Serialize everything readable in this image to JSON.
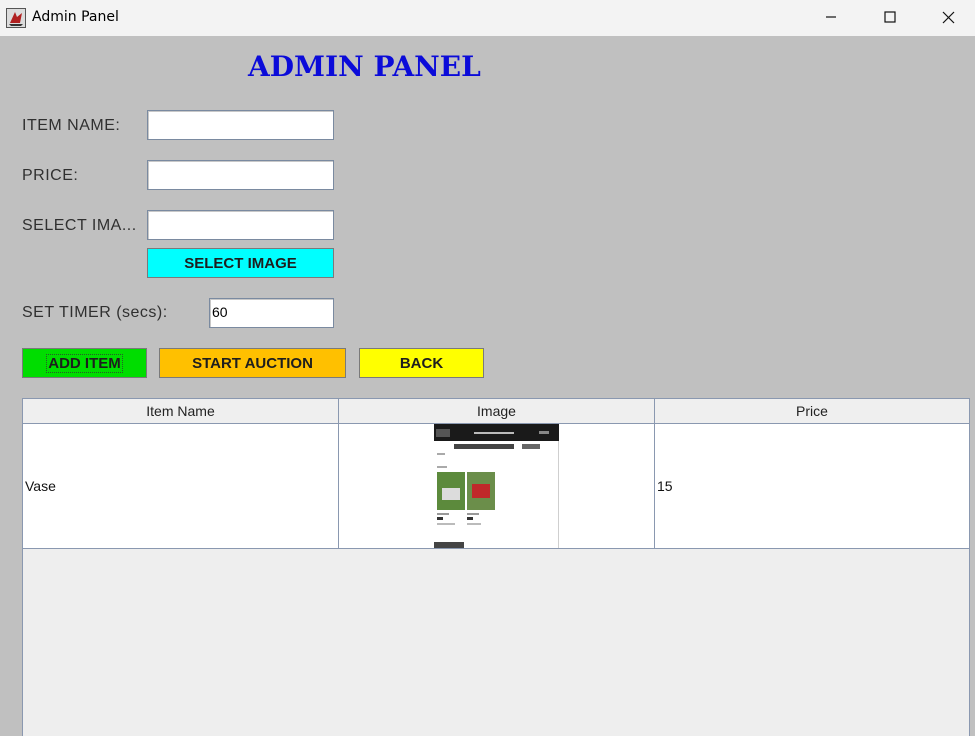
{
  "window": {
    "title": "Admin Panel"
  },
  "heading": "ADMIN PANEL",
  "form": {
    "item_name_label": "ITEM NAME:",
    "item_name_value": "",
    "price_label": "PRICE:",
    "price_value": "",
    "select_image_label": "SELECT IMA...",
    "select_image_value": "",
    "select_image_button": "SELECT IMAGE",
    "timer_label": "SET TIMER (secs):",
    "timer_value": "60"
  },
  "actions": {
    "add_item": "ADD ITEM",
    "start_auction": "START AUCTION",
    "back": "BACK"
  },
  "table": {
    "columns": [
      "Item Name",
      "Image",
      "Price"
    ],
    "rows": [
      {
        "item_name": "Vase",
        "image": "thumbnail",
        "price": "15"
      }
    ]
  },
  "colors": {
    "heading": "#0b0bd9",
    "select_image_button": "#00ffff",
    "add_item_button": "#00dd00",
    "start_auction_button": "#ffc000",
    "back_button": "#ffff00",
    "panel_background": "#c0c0c0"
  }
}
